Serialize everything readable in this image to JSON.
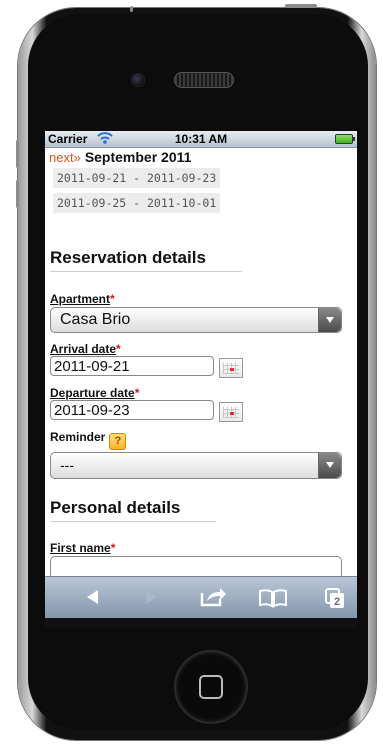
{
  "device": {
    "type": "iPhone simulator"
  },
  "status_bar": {
    "carrier": "Carrier",
    "time": "10:31 AM",
    "wifi_icon": "wifi-icon",
    "battery_icon": "battery-icon"
  },
  "calendar": {
    "next_link": "next»",
    "month_title": "September 2011",
    "reservations": [
      "2011-09-21 - 2011-09-23",
      "2011-09-25 - 2011-10-01"
    ]
  },
  "reservation_details": {
    "heading": "Reservation details",
    "apartment_label": "Apartment",
    "apartment_value": "Casa Brio",
    "arrival_label": "Arrival date",
    "arrival_value": "2011-09-21",
    "departure_label": "Departure date",
    "departure_value": "2011-09-23",
    "reminder_label": "Reminder",
    "reminder_value": "---",
    "required_marker": "*",
    "help_glyph": "?"
  },
  "personal_details": {
    "heading": "Personal details",
    "first_name_label": "First name",
    "first_name_value": ""
  },
  "toolbar": {
    "tabs_count": "2",
    "icons": [
      "back-icon",
      "forward-icon",
      "share-icon",
      "bookmarks-icon",
      "tabs-icon"
    ]
  },
  "colors": {
    "next_link": "#d8541a",
    "required": "#d01818",
    "toolbar": "#8295ac"
  }
}
